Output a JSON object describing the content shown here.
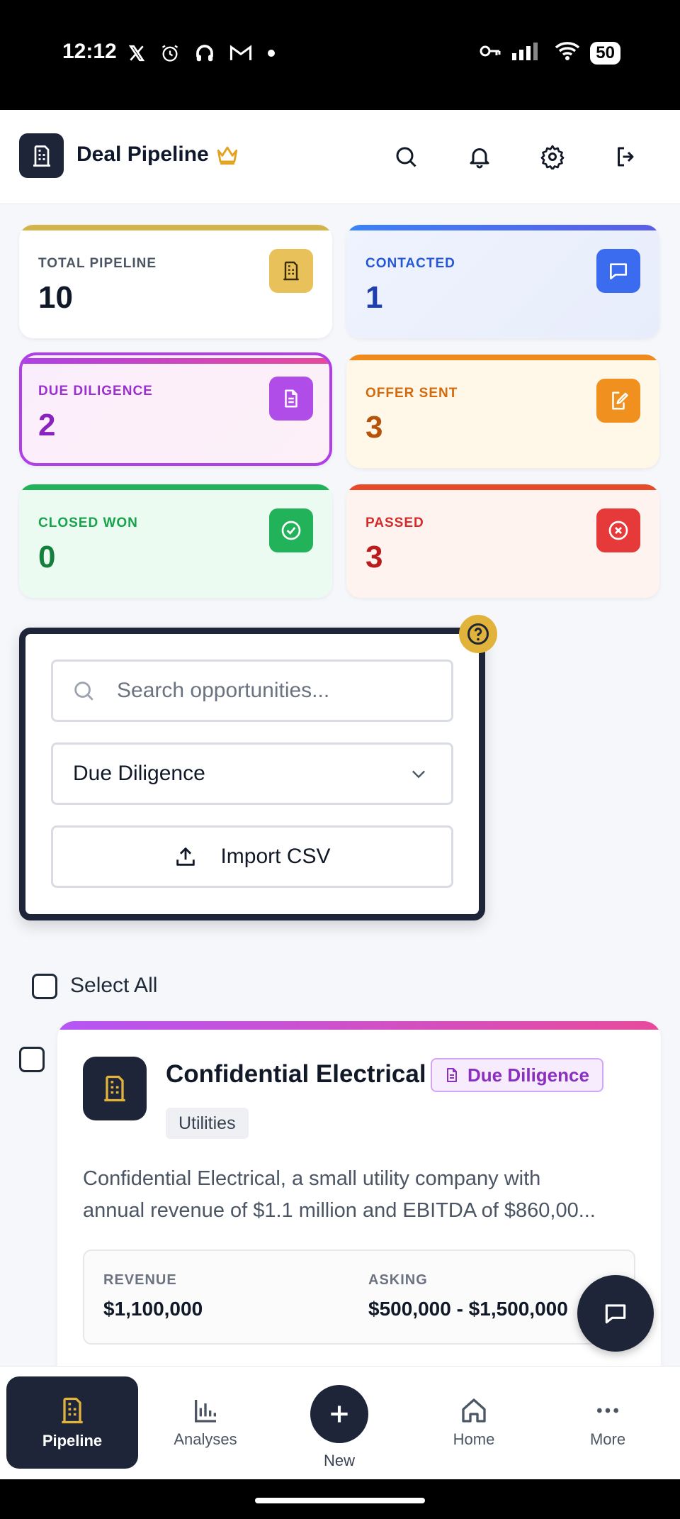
{
  "status_bar": {
    "time": "12:12",
    "left_icons": [
      "x-icon",
      "alarm-icon",
      "headphones-icon",
      "gmail-icon",
      "dot-icon"
    ],
    "right_icons": [
      "key-icon",
      "signal-icon",
      "wifi-icon"
    ],
    "battery": "50"
  },
  "header": {
    "title": "Deal Pipeline",
    "icons": [
      "search-icon",
      "bell-icon",
      "gear-icon",
      "logout-icon"
    ]
  },
  "stats": [
    {
      "label": "TOTAL PIPELINE",
      "value": "10",
      "accent": "#d4b44a"
    },
    {
      "label": "CONTACTED",
      "value": "1",
      "accent": "#3b6cf0"
    },
    {
      "label": "DUE DILIGENCE",
      "value": "2",
      "accent": "#b03fe6",
      "selected": true
    },
    {
      "label": "OFFER SENT",
      "value": "3",
      "accent": "#f08a1c"
    },
    {
      "label": "CLOSED WON",
      "value": "0",
      "accent": "#22b35a"
    },
    {
      "label": "PASSED",
      "value": "3",
      "accent": "#e63a3a"
    }
  ],
  "filters": {
    "search_placeholder": "Search opportunities...",
    "stage_select": "Due Diligence",
    "import_label": "Import CSV"
  },
  "select_all_label": "Select All",
  "deal": {
    "name": "Confidential Electrical",
    "status": "Due Diligence",
    "tag": "Utilities",
    "description_line1": "Confidential Electrical, a small utility company with",
    "description_line2": "annual revenue of $1.1 million and EBITDA of $860,00...",
    "revenue_label": "REVENUE",
    "revenue_value": "$1,100,000",
    "asking_label": "ASKING",
    "asking_value": "$500,000 - $1,500,000"
  },
  "nav": {
    "pipeline": "Pipeline",
    "analyses": "Analyses",
    "new": "New",
    "home": "Home",
    "more": "More"
  },
  "colors": {
    "navy": "#1e2538",
    "gold": "#e2b33b",
    "purple": "#8a2fc0"
  }
}
